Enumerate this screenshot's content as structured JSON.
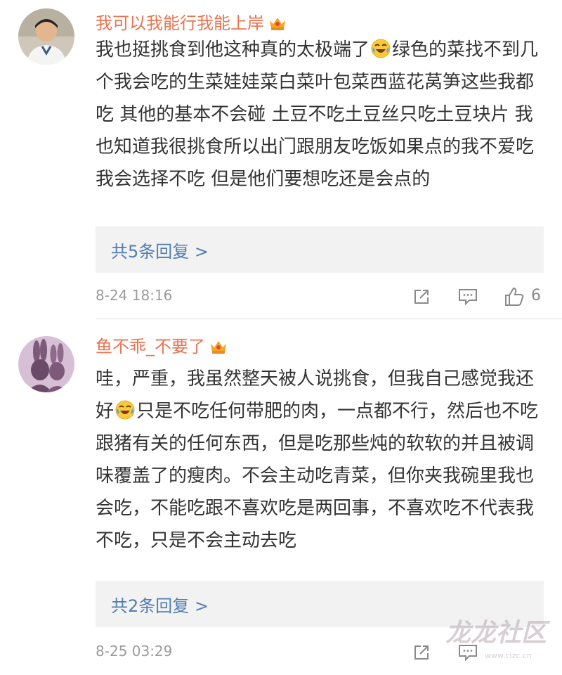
{
  "comments": [
    {
      "username": "我可以我能行我能上岸",
      "text_before_emoji": "我也挺挑食到他这种真的太极端了",
      "text_after_emoji": "绿色的菜找不到几个我会吃的生菜娃娃菜白菜叶包菜西蓝花莴笋这些我都吃 其他的基本不会碰 土豆不吃土豆丝只吃土豆块片 我也知道我很挑食所以出门跟朋友吃饭如果点的我不爱吃我会选择不吃 但是他们要想吃还是会点的",
      "reply_link": "共5条回复 >",
      "timestamp": "8-24 18:16",
      "like_count": "6"
    },
    {
      "username": "鱼不乖_不要了",
      "text_before_emoji": "哇，严重，我虽然整天被人说挑食，但我自己感觉我还好",
      "text_after_emoji": "只是不吃任何带肥的肉，一点都不行，然后也不吃跟猪有关的任何东西，但是吃那些炖的软软的并且被调味覆盖了的瘦肉。不会主动吃青菜，但你夹我碗里我也会吃，不能吃跟不喜欢吃是两回事，不喜欢吃不代表我不吃，只是不会主动去吃",
      "reply_link": "共2条回复 >",
      "timestamp": "8-25 03:29",
      "like_count": ""
    }
  ],
  "icons": {
    "crown": "crown-icon",
    "emoji": "laughing-crying-emoji-icon",
    "share": "share-icon",
    "reply": "comment-icon",
    "like": "thumbs-up-icon"
  },
  "colors": {
    "username": "#eb7350",
    "link": "#507daf",
    "text": "#333333",
    "meta": "#9b9b9b",
    "reply_box": "#f2f2f2"
  },
  "watermark": {
    "main": "龙龙社区",
    "sub": "www.clzc.cn"
  }
}
